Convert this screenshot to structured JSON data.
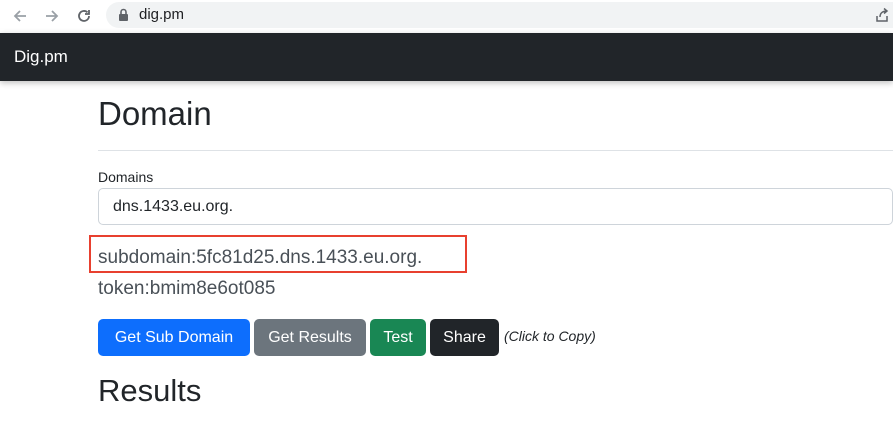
{
  "browser": {
    "url": "dig.pm",
    "icons": [
      "back-arrow-icon",
      "forward-arrow-icon",
      "reload-icon",
      "lock-icon",
      "share-page-icon"
    ]
  },
  "navbar": {
    "brand": "Dig.pm",
    "background": "#212529"
  },
  "main": {
    "title": "Domain",
    "domains_label": "Domains",
    "domains_value": "dns.1433.eu.org.",
    "subdomain_text": "subdomain:5fc81d25.dns.1433.eu.org.",
    "token_text": "token:bmim8e6ot085",
    "buttons": {
      "get_sub_domain": "Get Sub Domain",
      "get_results": "Get Results",
      "test": "Test",
      "share": "Share"
    },
    "copy_hint": "(Click to Copy)",
    "results_title": "Results"
  },
  "colors": {
    "primary": "#0d6efd",
    "secondary": "#6c757d",
    "success": "#198754",
    "dark": "#212529",
    "highlight": "#e8402f"
  }
}
